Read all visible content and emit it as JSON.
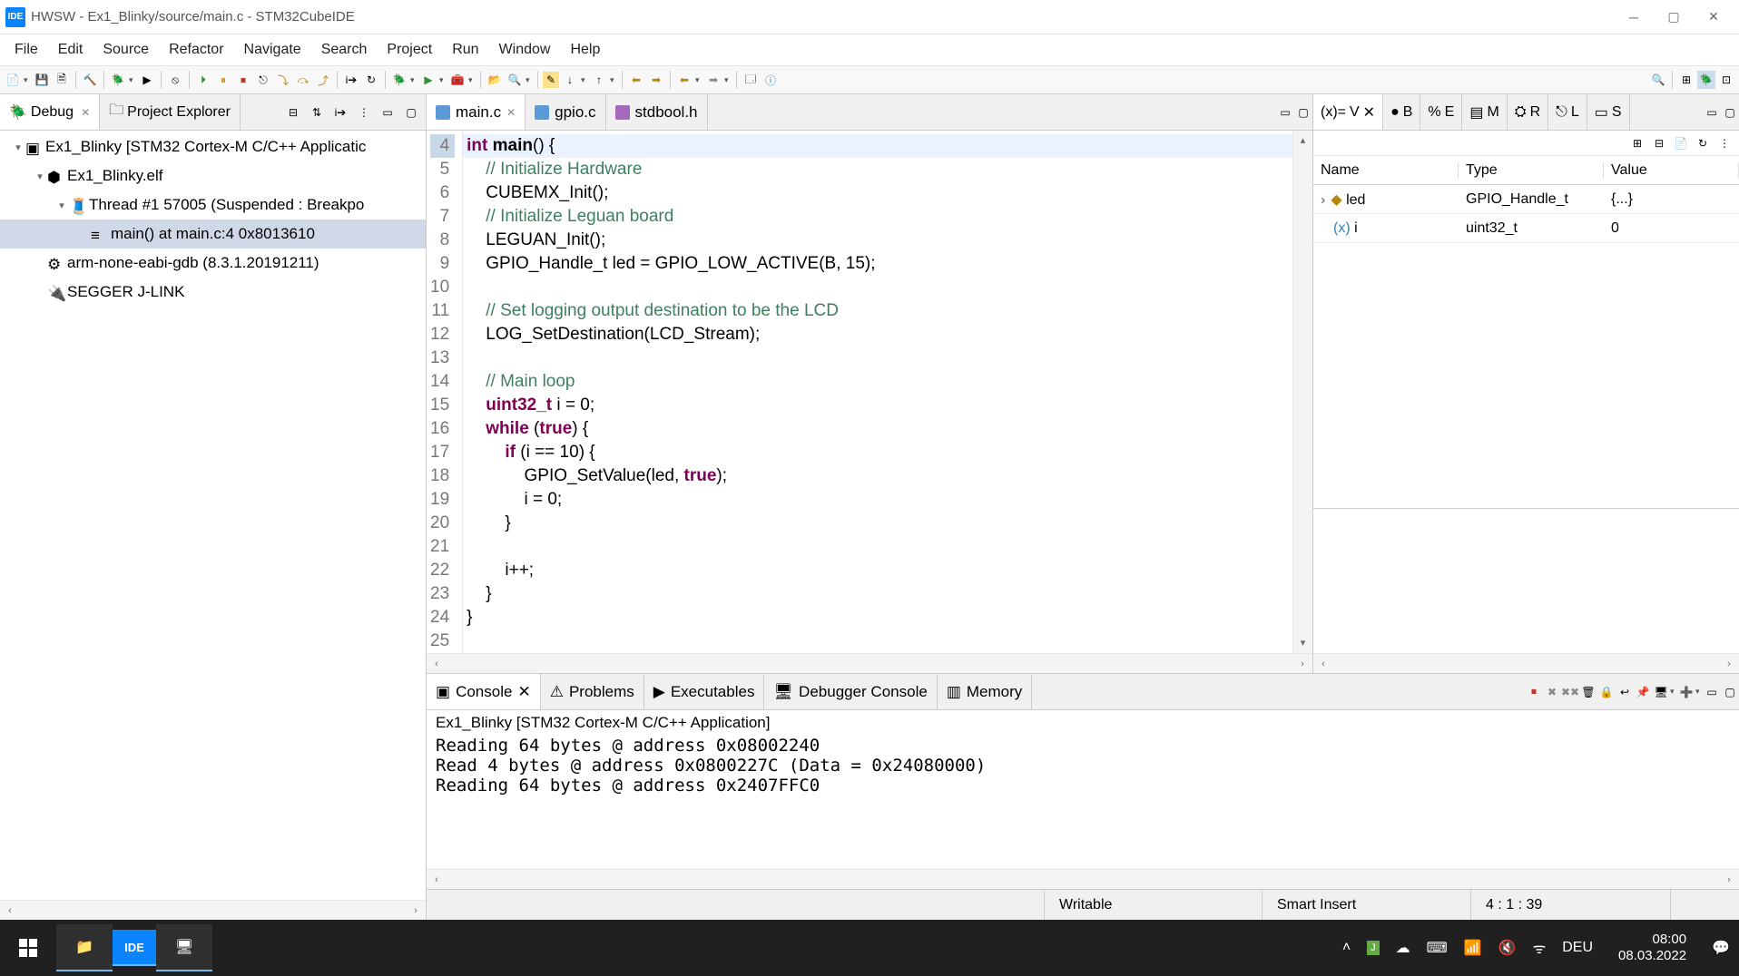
{
  "window": {
    "logo_text": "IDE",
    "title": "HWSW - Ex1_Blinky/source/main.c - STM32CubeIDE"
  },
  "menu": [
    "File",
    "Edit",
    "Source",
    "Refactor",
    "Navigate",
    "Search",
    "Project",
    "Run",
    "Window",
    "Help"
  ],
  "leftpane": {
    "tabs": [
      {
        "label": "Debug",
        "active": true
      },
      {
        "label": "Project Explorer",
        "active": false
      }
    ],
    "tree": [
      {
        "indent": 0,
        "expand": "▾",
        "icon": "app",
        "label": "Ex1_Blinky [STM32 Cortex-M C/C++ Applicatic",
        "selected": false
      },
      {
        "indent": 1,
        "expand": "▾",
        "icon": "elf",
        "label": "Ex1_Blinky.elf",
        "selected": false
      },
      {
        "indent": 2,
        "expand": "▾",
        "icon": "thread",
        "label": "Thread #1 57005 (Suspended : Breakpo",
        "selected": false
      },
      {
        "indent": 3,
        "expand": "",
        "icon": "frame",
        "label": "main() at main.c:4 0x8013610",
        "selected": true
      },
      {
        "indent": 1,
        "expand": "",
        "icon": "gdb",
        "label": "arm-none-eabi-gdb (8.3.1.20191211)",
        "selected": false
      },
      {
        "indent": 1,
        "expand": "",
        "icon": "jlink",
        "label": "SEGGER J-LINK",
        "selected": false
      }
    ]
  },
  "editor": {
    "tabs": [
      {
        "label": "main.c",
        "icon": "c",
        "active": true,
        "close": true
      },
      {
        "label": "gpio.c",
        "icon": "c",
        "active": false,
        "close": false
      },
      {
        "label": "stdbool.h",
        "icon": "h",
        "active": false,
        "close": false
      }
    ],
    "first_line": 4,
    "breakpoint_line": 4,
    "highlight_line": 4,
    "lines": [
      {
        "n": 4,
        "html": "<span class='kw'>int</span> <span class='fn'>main</span>() {"
      },
      {
        "n": 5,
        "html": "    <span class='cm'>// Initialize Hardware</span>"
      },
      {
        "n": 6,
        "html": "    CUBEMX_Init();"
      },
      {
        "n": 7,
        "html": "    <span class='cm'>// Initialize Leguan board</span>"
      },
      {
        "n": 8,
        "html": "    LEGUAN_Init();"
      },
      {
        "n": 9,
        "html": "    GPIO_Handle_t led = GPIO_LOW_ACTIVE(B, 15);"
      },
      {
        "n": 10,
        "html": ""
      },
      {
        "n": 11,
        "html": "    <span class='cm'>// Set logging output destination to be the LCD</span>"
      },
      {
        "n": 12,
        "html": "    LOG_SetDestination(LCD_Stream);"
      },
      {
        "n": 13,
        "html": ""
      },
      {
        "n": 14,
        "html": "    <span class='cm'>// Main loop</span>"
      },
      {
        "n": 15,
        "html": "    <span class='kw'>uint32_t</span> i = 0;"
      },
      {
        "n": 16,
        "html": "    <span class='kw'>while</span> (<span class='kw'>true</span>) {"
      },
      {
        "n": 17,
        "html": "        <span class='kw'>if</span> (i == 10) {"
      },
      {
        "n": 18,
        "html": "            GPIO_SetValue(led, <span class='kw'>true</span>);"
      },
      {
        "n": 19,
        "html": "            i = 0;"
      },
      {
        "n": 20,
        "html": "        }"
      },
      {
        "n": 21,
        "html": ""
      },
      {
        "n": 22,
        "html": "        i++;"
      },
      {
        "n": 23,
        "html": "    }"
      },
      {
        "n": 24,
        "html": "}"
      },
      {
        "n": 25,
        "html": ""
      }
    ]
  },
  "variables": {
    "tabs": [
      "V",
      "B",
      "E",
      "M",
      "R",
      "L",
      "S"
    ],
    "active_tab": 0,
    "columns": [
      "Name",
      "Type",
      "Value"
    ],
    "rows": [
      {
        "expand": "›",
        "icon": "struct",
        "name": "led",
        "type": "GPIO_Handle_t",
        "value": "{...}"
      },
      {
        "expand": "",
        "icon": "var",
        "name": "i",
        "type": "uint32_t",
        "value": "0"
      }
    ]
  },
  "bottom": {
    "tabs": [
      {
        "label": "Console",
        "active": true,
        "close": true
      },
      {
        "label": "Problems",
        "active": false
      },
      {
        "label": "Executables",
        "active": false
      },
      {
        "label": "Debugger Console",
        "active": false
      },
      {
        "label": "Memory",
        "active": false
      }
    ],
    "title": "Ex1_Blinky [STM32 Cortex-M C/C++ Application]",
    "output": "Reading 64 bytes @ address 0x08002240\nRead 4 bytes @ address 0x0800227C (Data = 0x24080000)\nReading 64 bytes @ address 0x2407FFC0"
  },
  "statusbar": {
    "writable": "Writable",
    "insert": "Smart Insert",
    "pos": "4 : 1 : 39"
  },
  "taskbar": {
    "lang": "DEU",
    "time": "08:00",
    "date": "08.03.2022"
  }
}
